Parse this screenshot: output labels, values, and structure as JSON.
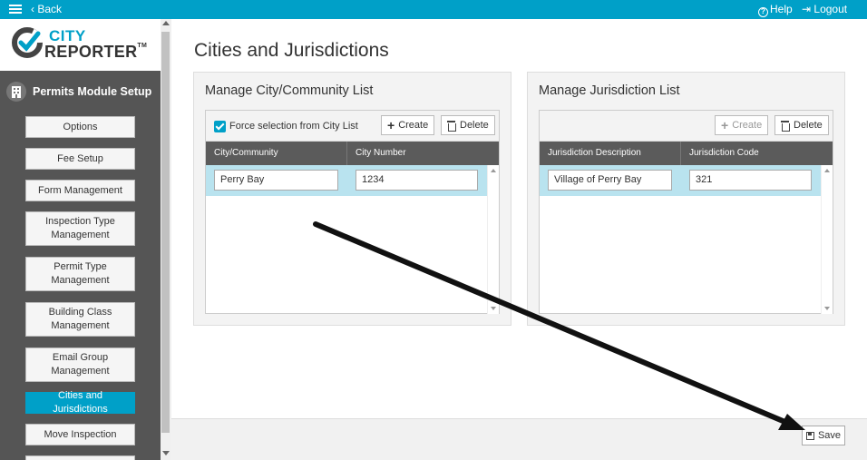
{
  "topbar": {
    "back_label": "Back",
    "help_label": "Help",
    "logout_label": "Logout",
    "menu_icon": "hamburger-icon",
    "color": "#00a0c8"
  },
  "logo": {
    "line1": "CITY",
    "line2": "REPORTER",
    "tm": "TM"
  },
  "sidebar": {
    "title": "Permits Module Setup",
    "items": [
      {
        "label": "Options"
      },
      {
        "label": "Fee Setup"
      },
      {
        "label": "Form Management"
      },
      {
        "label": "Inspection Type Management"
      },
      {
        "label": "Permit Type Management"
      },
      {
        "label": "Building Class Management"
      },
      {
        "label": "Email Group Management"
      },
      {
        "label": "Cities and Jurisdictions",
        "active": true
      },
      {
        "label": "Move Inspection"
      }
    ]
  },
  "page": {
    "title": "Cities and Jurisdictions"
  },
  "city_panel": {
    "title": "Manage City/Community List",
    "force_selection_label": "Force selection from City List",
    "force_selection_checked": true,
    "create_label": "Create",
    "delete_label": "Delete",
    "columns": [
      "City/Community",
      "City Number"
    ],
    "rows": [
      {
        "city": "Perry Bay",
        "number": "1234"
      }
    ]
  },
  "jurisdiction_panel": {
    "title": "Manage Jurisdiction List",
    "create_label": "Create",
    "delete_label": "Delete",
    "columns": [
      "Jurisdiction Description",
      "Jurisdiction Code"
    ],
    "rows": [
      {
        "description": "Village of Perry Bay",
        "code": "321"
      }
    ]
  },
  "footer": {
    "save_label": "Save"
  }
}
